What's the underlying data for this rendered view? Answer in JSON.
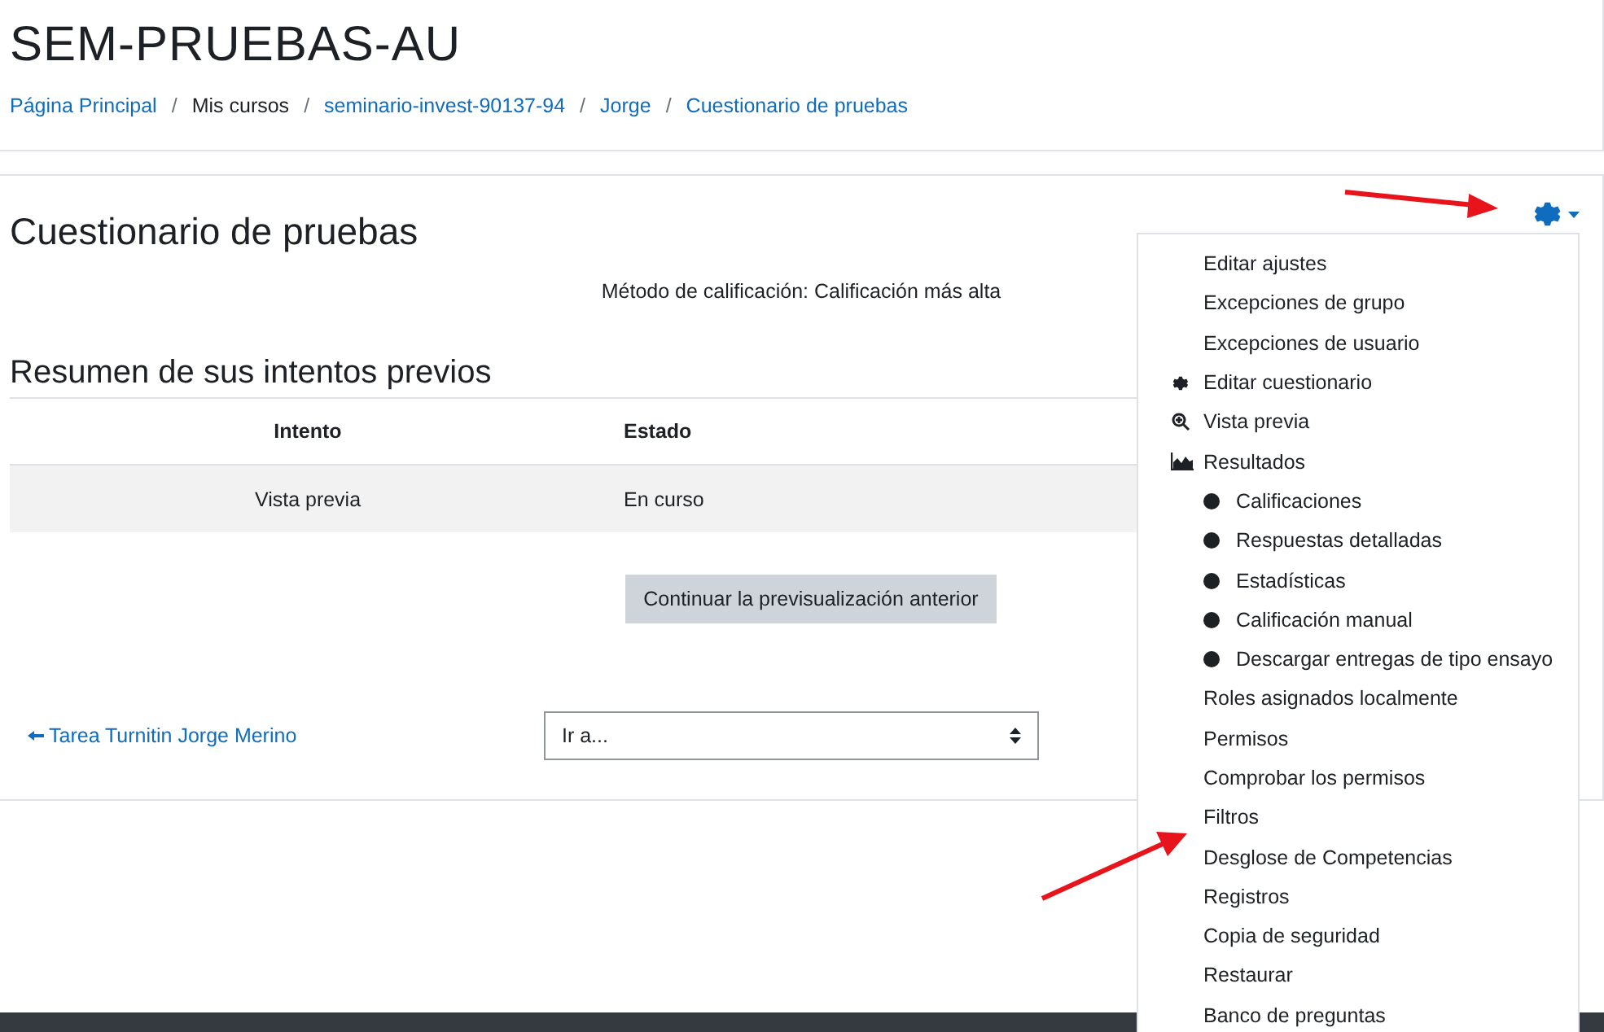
{
  "header": {
    "title": "SEM-PRUEBAS-AU",
    "breadcrumb": [
      {
        "label": "Página Principal",
        "link": true
      },
      {
        "label": "Mis cursos",
        "link": false
      },
      {
        "label": "seminario-invest-90137-94",
        "link": true
      },
      {
        "label": "Jorge",
        "link": true
      },
      {
        "label": "Cuestionario de pruebas",
        "link": true
      }
    ],
    "separator": "/"
  },
  "main": {
    "title": "Cuestionario de pruebas",
    "grading_method": "Método de calificación: Calificación más alta",
    "summary_title": "Resumen de sus intentos previos",
    "table": {
      "columns": [
        "Intento",
        "Estado"
      ],
      "rows": [
        [
          "Vista previa",
          "En curso"
        ]
      ]
    },
    "continue_button": "Continuar la previsualización anterior",
    "prev_link": "Tarea Turnitin Jorge Merino",
    "jump_select": {
      "value": "Ir a..."
    }
  },
  "settings_menu": {
    "items": [
      {
        "label": "Editar ajustes",
        "kind": "plain"
      },
      {
        "label": "Excepciones de grupo",
        "kind": "plain"
      },
      {
        "label": "Excepciones de usuario",
        "kind": "plain"
      },
      {
        "label": "Editar cuestionario",
        "kind": "gear"
      },
      {
        "label": "Vista previa",
        "kind": "magnifier"
      },
      {
        "label": "Resultados",
        "kind": "chart",
        "children": [
          {
            "label": "Calificaciones"
          },
          {
            "label": "Respuestas detalladas"
          },
          {
            "label": "Estadísticas"
          },
          {
            "label": "Calificación manual"
          },
          {
            "label": "Descargar entregas de tipo ensayo"
          }
        ]
      },
      {
        "label": "Roles asignados localmente",
        "kind": "plain"
      },
      {
        "label": "Permisos",
        "kind": "plain"
      },
      {
        "label": "Comprobar los permisos",
        "kind": "plain"
      },
      {
        "label": "Filtros",
        "kind": "plain"
      },
      {
        "label": "Desglose de Competencias",
        "kind": "plain"
      },
      {
        "label": "Registros",
        "kind": "plain"
      },
      {
        "label": "Copia de seguridad",
        "kind": "plain"
      },
      {
        "label": "Restaurar",
        "kind": "plain"
      },
      {
        "label": "Banco de preguntas",
        "kind": "plain"
      }
    ]
  }
}
